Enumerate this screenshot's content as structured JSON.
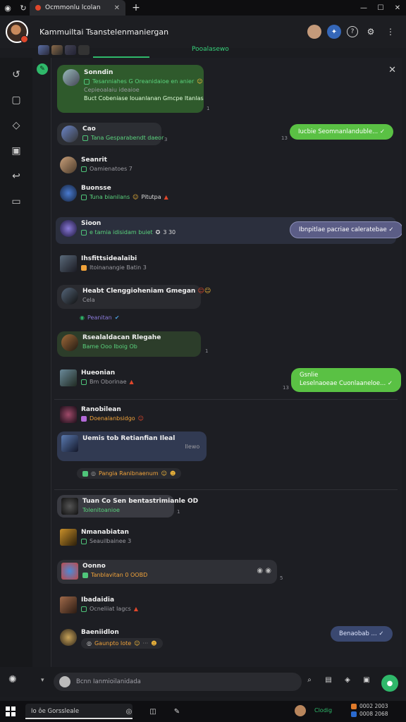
{
  "browser": {
    "tab_title": "Ocmmonlu lcolan",
    "close_glyph": "✕",
    "new_tab_glyph": "+",
    "window_controls": [
      "—",
      "☐",
      "✕"
    ]
  },
  "header": {
    "title": "Kammuiltai Tsanstelenmaniergan"
  },
  "substrip": {
    "active_label": "Pooalasewo"
  },
  "rail": {
    "icons": [
      "sync-icon",
      "chat-icon",
      "tag-icon",
      "image-icon",
      "share-icon",
      "caption-icon"
    ]
  },
  "messages": [
    {
      "name": "Sonndin",
      "line1": "Tesanniahes  G  Oreanidaioe  en  anier",
      "line2": "Cepieoalaiu  ideaioe",
      "line3": "Buct  Cobeniase  Iouanlanan  Gmcpe  Itanlas",
      "stamp": "1"
    },
    {
      "name": "Cao",
      "line1": "Tana  Gesparabendt  daeor",
      "stamp": "3"
    },
    {
      "name": "Seanrit",
      "line1": "Oamienatoes  7"
    },
    {
      "name": "Buonsse",
      "line1": "Tuna  bianilans",
      "line1b": "Pitutpa"
    },
    {
      "name": "Sioon",
      "line1": "e  tamia  idisidam  buiet",
      "line1b": "3  30"
    },
    {
      "name": "Ihsfittsidealaibi",
      "line1": "Itoinanangie  Batin  3"
    },
    {
      "name": "Heabt  Clenggioheniam  Gmegan",
      "line1": "Cela"
    },
    {
      "name": "Peanitan"
    },
    {
      "name": "Rsealaldacan  Rlegahe",
      "line1": "Bame  Ooo  Iboig  Ob",
      "stamp": "1"
    },
    {
      "name": "Hueonian",
      "line1": "Bm  Oborinae"
    },
    {
      "name": "Ranobilean",
      "line1": "Doenalanbsidgo"
    },
    {
      "name": "Uemis  tob  Retianfian  Ileal",
      "line1b": "Ilewo"
    },
    {
      "name": "Pangia  Ranibnaenum"
    },
    {
      "name": "Tuan  Co  Sen  bentastrimianle  OD",
      "line1": "Tolenitoanioe",
      "stamp": "1"
    },
    {
      "name": "Nmanabiatan",
      "line1": "Seauilbainee  3"
    },
    {
      "name": "Oonno",
      "line1": "Tanblavitan  0  OOBD",
      "stamp": "5"
    },
    {
      "name": "Ibadaidia",
      "line1": "Ocneliiat  Iagcs"
    },
    {
      "name": "Baeniidlon",
      "line1": "Gaunpto  Iote"
    }
  ],
  "outgoing": [
    {
      "text": "Iucbie  Seomnanlanduble...",
      "stamp": "13"
    },
    {
      "text": "Ibnpitlae  pacriae  caleratebae"
    },
    {
      "text": "Gsnlie",
      "text2": "Leselnaoeae  Cuonlaaneloe...",
      "stamp": "13"
    },
    {
      "text": "Benaobab  ..."
    }
  ],
  "composer": {
    "placeholder": "Bcnn  Ianmioilanidada"
  },
  "taskbar": {
    "search_text": "Io  ôe  Gorssleale",
    "tray_label": "Clodig",
    "clock_line1": "0002  2003",
    "clock_line2": "0008  2068"
  },
  "colors": {
    "accent_green": "#2fb86a",
    "bubble_green": "#5ac144",
    "bubble_violet": "#5b5d86",
    "bubble_navy": "#3a4870"
  }
}
